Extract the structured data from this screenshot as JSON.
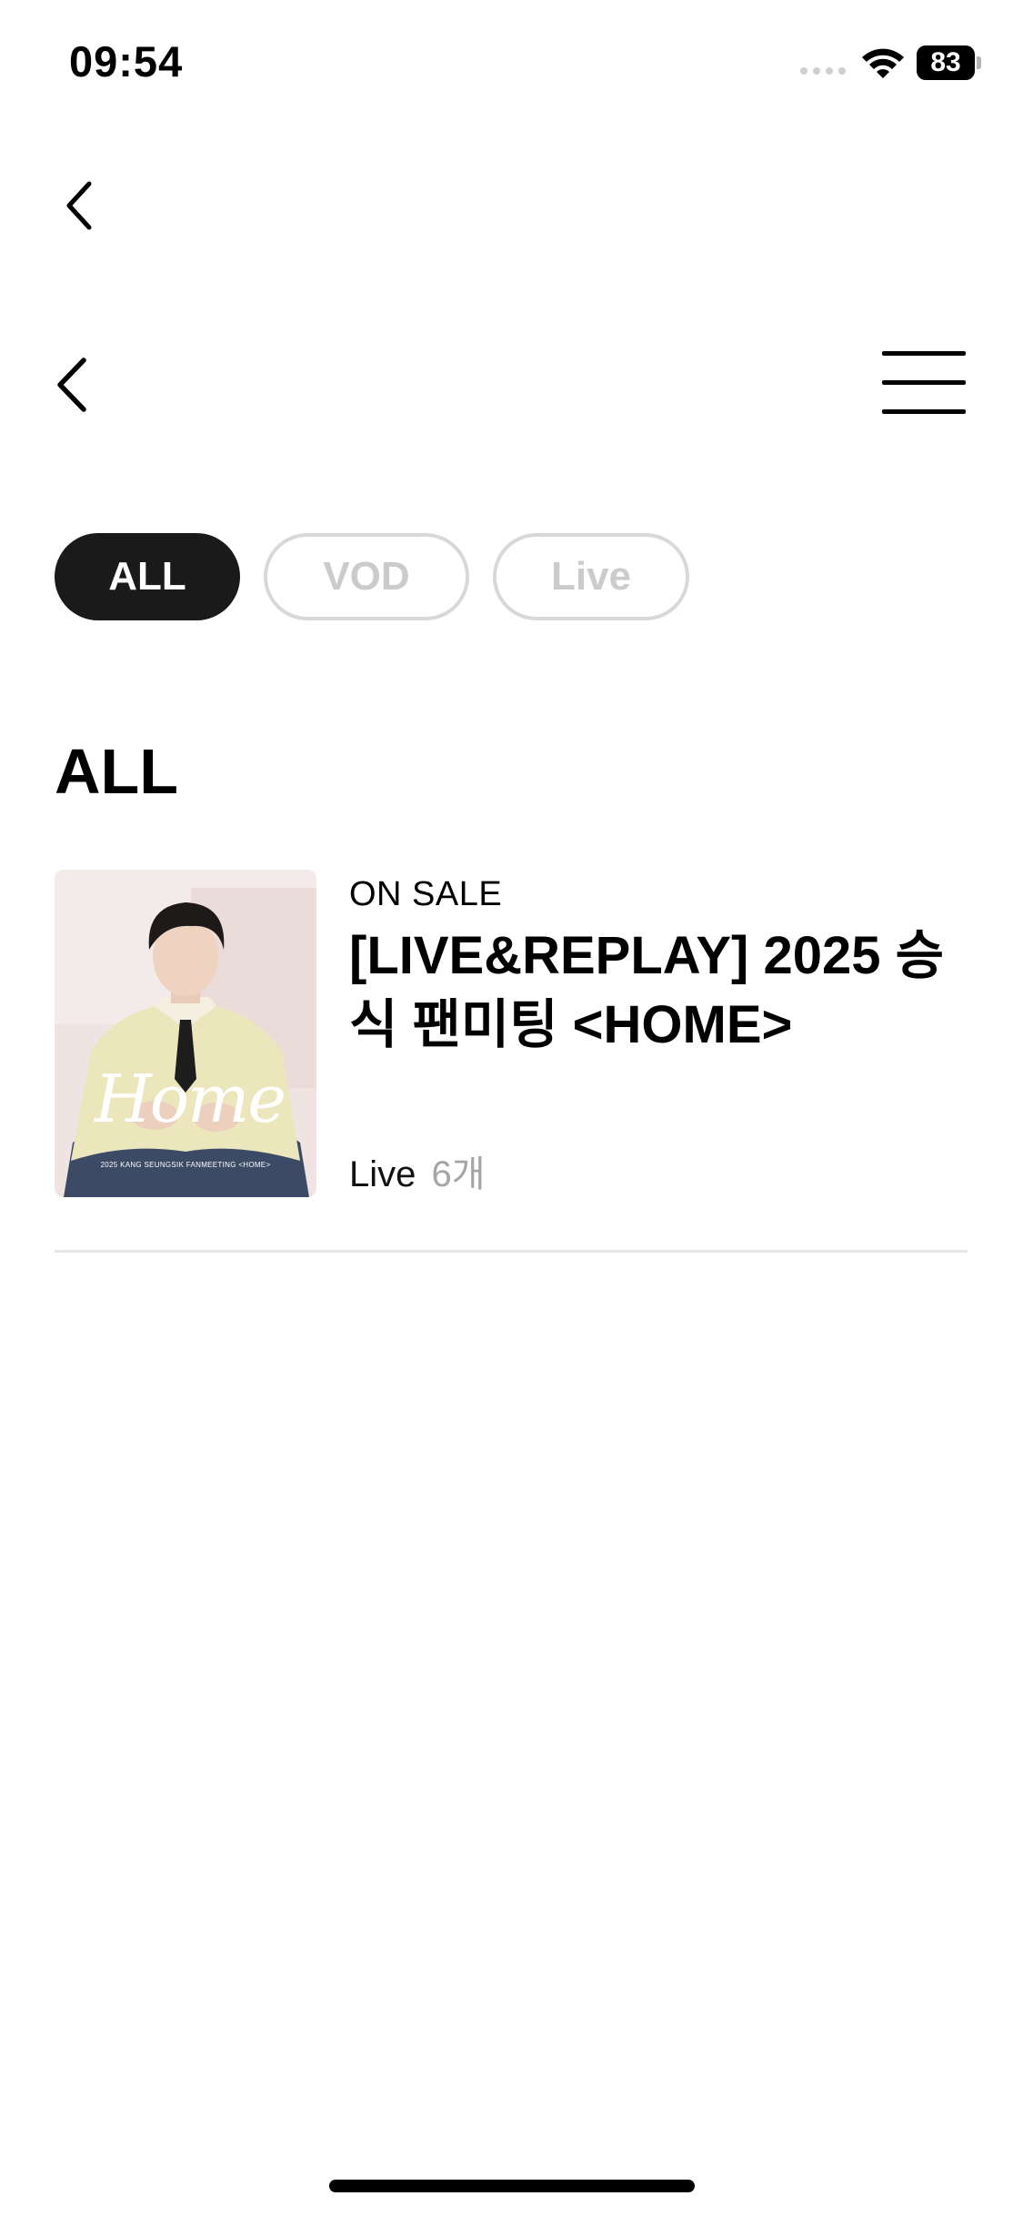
{
  "status_bar": {
    "time": "09:54",
    "battery": "83",
    "icons": [
      "cellular-signal-icon",
      "wifi-icon",
      "battery-icon"
    ]
  },
  "nav": {
    "top_back_icon": "chevron-left-icon",
    "back_icon": "chevron-left-icon",
    "menu_icon": "hamburger-menu-icon"
  },
  "filters": [
    {
      "label": "ALL",
      "active": true
    },
    {
      "label": "VOD",
      "active": false
    },
    {
      "label": "Live",
      "active": false
    }
  ],
  "section": {
    "title": "ALL"
  },
  "products": [
    {
      "status": "ON SALE",
      "title": "[LIVE&REPLAY] 2025 승식 팬미팅 <HOME>",
      "thumbnail_text": "Home",
      "thumbnail_caption": "2025 KANG SEUNGSIK FANMEETING <HOME>",
      "type": "Live",
      "count": "6개"
    }
  ],
  "colors": {
    "chip_active_bg": "#1a1a1a",
    "chip_inactive_text": "#cbcbcb",
    "count_text": "#a5a5a5"
  }
}
